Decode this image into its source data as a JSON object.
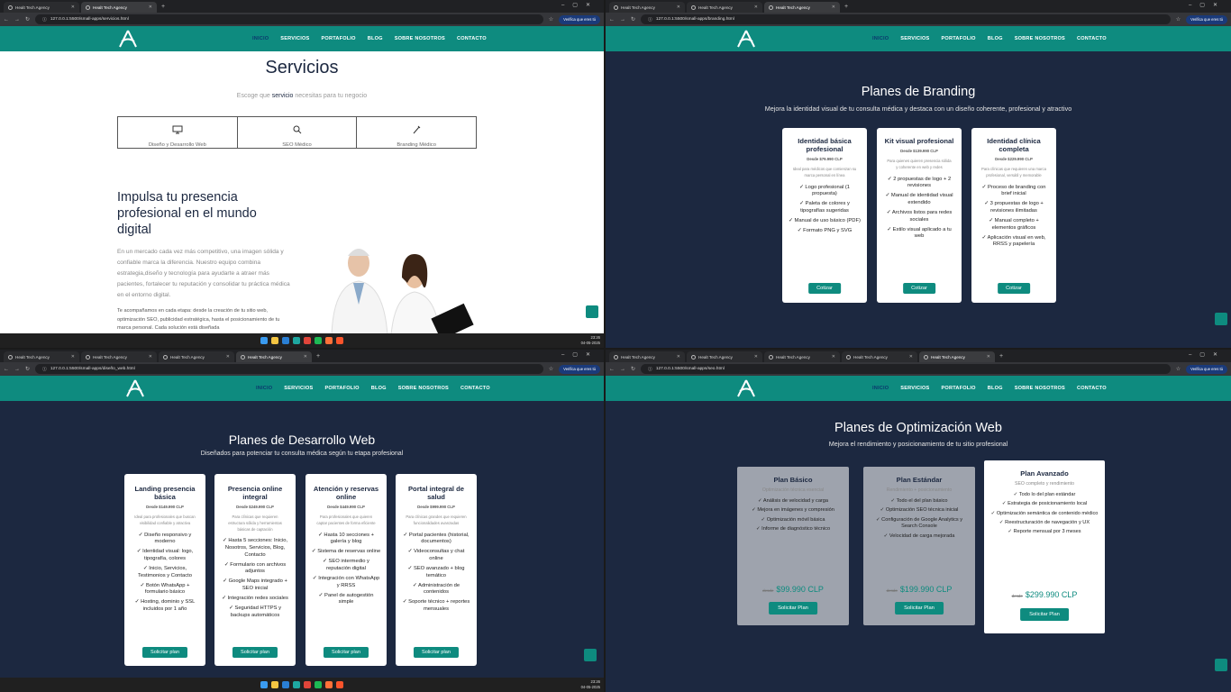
{
  "common": {
    "tab_title": "Healt Tech Agency",
    "verify_label": "Verifica que eres tú",
    "nav": [
      "INICIO",
      "SERVICIOS",
      "PORTAFOLIO",
      "BLOG",
      "SOBRE NOSOTROS",
      "CONTACTO"
    ],
    "colors": {
      "accent": "#0e8b7f",
      "dark_bg": "#1c2840",
      "home_link": "#0b3a6e"
    },
    "clock_time": "23:26",
    "clock_date": "04-05-2025"
  },
  "q1": {
    "url": "127.0.0.1:5500/small-apps/servicios.html",
    "title": "Servicios",
    "subtitle_pre": "Escoge que ",
    "subtitle_bold": "servicio",
    "subtitle_post": " necesitas para tu negocio",
    "services": [
      {
        "label": "Diseño y Desarrollo Web",
        "icon": "monitor-icon"
      },
      {
        "label": "SEO Médico",
        "icon": "search-icon"
      },
      {
        "label": "Branding Médico",
        "icon": "pen-icon"
      }
    ],
    "hero_title": "Impulsa tu presencia profesional en el mundo digital",
    "hero_p1": "En un mercado cada vez más competitivo, una imagen sólida y confiable marca la diferencia. Nuestro equipo combina estrategia,diseño y tecnología para ayudarte a atraer más pacientes, fortalecer tu reputación y consolidar tu práctica médica en el entorno digital.",
    "hero_p2": "Te acompañamos en cada etapa: desde la creación de tu sitio web, optimización SEO, publicidad estratégica, hasta el posicionamiento de tu marca personal. Cada solución está diseñada"
  },
  "q2": {
    "url": "127.0.0.1:5500/small-apps/branding.html",
    "title": "Planes de Branding",
    "subtitle": "Mejora la identidad visual de tu consulta médica y destaca con un diseño coherente, profesional y atractivo",
    "button": "Cotizar",
    "cards": [
      {
        "title": "Identidad básica profesional",
        "price": "Desde $79.990 CLP",
        "desc": "Ideal para médicos que comienzan su marca personal en línea",
        "items": [
          "✓ Logo profesional (1 propuesta)",
          "✓ Paleta de colores y tipografías sugeridas",
          "✓ Manual de uso básico (PDF)",
          "✓ Formato PNG y SVG"
        ]
      },
      {
        "title": "Kit visual profesional",
        "price": "Desde $139.990 CLP",
        "desc": "Para quienes quieren presencia sólida y coherente en web y redes",
        "items": [
          "✓ 2 propuestas de logo + 2 revisiones",
          "✓ Manual de identidad visual extendido",
          "✓ Archivos listos para redes sociales",
          "✓ Estilo visual aplicado a tu web"
        ]
      },
      {
        "title": "Identidad clínica completa",
        "price": "Desde $229.990 CLP",
        "desc": "Para clínicas que requieren una marca profesional, versátil y memorable",
        "items": [
          "✓ Proceso de branding con brief inicial",
          "✓ 3 propuestas de logo + revisiones ilimitadas",
          "✓ Manual completo + elementos gráficos",
          "✓ Aplicación visual en web, RRSS y papelería"
        ]
      }
    ]
  },
  "q3": {
    "url": "127.0.0.1:5500/small-apps/diseño_web.html",
    "title": "Planes de Desarrollo Web",
    "subtitle": "Diseñados para potenciar tu consulta médica según tu etapa profesional",
    "button": "Solicitar plan",
    "cards": [
      {
        "title": "Landing presencia básica",
        "price": "Desde $149.990 CLP",
        "desc": "Ideal para profesionales que buscan visibilidad confiable y atractiva",
        "items": [
          "✓ Diseño responsivo y moderno",
          "✓ Identidad visual: logo, tipografía, colores",
          "✓ Inicio, Servicios, Testimonios y Contacto",
          "✓ Botón WhatsApp + formulario básico",
          "✓ Hosting, dominio y SSL incluidos por 1 año"
        ]
      },
      {
        "title": "Presencia online integral",
        "price": "Desde $249.990 CLP",
        "desc": "Para clínicas que requieren estructura sólida y herramientas básicas de captación",
        "items": [
          "✓ Hasta 5 secciones: Inicio, Nosotros, Servicios, Blog, Contacto",
          "✓ Formulario con archivos adjuntos",
          "✓ Google Maps integrado + SEO inicial",
          "✓ Integración redes sociales",
          "✓ Seguridad HTTPS y backups automáticos"
        ]
      },
      {
        "title": "Atención y reservas online",
        "price": "Desde $449.990 CLP",
        "desc": "Para profesionales que quieren captar pacientes de forma eficiente",
        "items": [
          "✓ Hasta 10 secciones + galería y blog",
          "✓ Sistema de reservas online",
          "✓ SEO intermedio y reputación digital",
          "✓ Integración con WhatsApp y RRSS",
          "✓ Panel de autogestión simple"
        ]
      },
      {
        "title": "Portal integral de salud",
        "price": "Desde $999.990 CLP",
        "desc": "Para clínicas grandes que requieren funcionalidades avanzadas",
        "items": [
          "✓ Portal pacientes (historial, documentos)",
          "✓ Videoconsultas y chat online",
          "✓ SEO avanzado + blog temático",
          "✓ Administración de contenidos",
          "✓ Soporte técnico + reportes mensuales"
        ]
      }
    ]
  },
  "q4": {
    "url": "127.0.0.1:5500/small-apps/seo.html",
    "title": "Planes de Optimización Web",
    "subtitle": "Mejora el rendimiento y posicionamiento de tu sitio profesional",
    "button": "Solicitar Plan",
    "cards": [
      {
        "title": "Plan Básico",
        "sub": "Optimización técnica esencial",
        "items": [
          "✓ Análisis de velocidad y carga",
          "✓ Mejora en imágenes y compresión",
          "✓ Optimización móvil básica",
          "✓ Informe de diagnóstico técnico"
        ],
        "old": "desde",
        "price": "$99.990 CLP"
      },
      {
        "title": "Plan Estándar",
        "sub": "Rendimiento + posicionamiento",
        "items": [
          "✓ Todo el del plan básico",
          "✓ Optimización SEO técnica inicial",
          "✓ Configuración de Google Analytics y Search Console",
          "✓ Velocidad de carga mejorada"
        ],
        "old": "desde",
        "price": "$199.990 CLP"
      },
      {
        "title": "Plan Avanzado",
        "sub": "SEO completo y rendimiento",
        "items": [
          "✓ Todo lo del plan estándar",
          "✓ Estrategia de posicionamiento local",
          "✓ Optimización semántica de contenido médico",
          "✓ Reestructuración de navegación y UX",
          "✓ Reporte mensual por 3 meses"
        ],
        "old": "desde",
        "price": "$299.990 CLP"
      }
    ]
  }
}
